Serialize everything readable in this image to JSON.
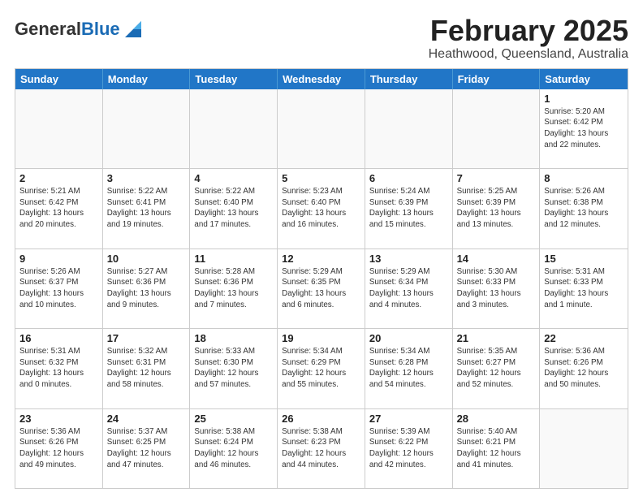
{
  "header": {
    "logo_general": "General",
    "logo_blue": "Blue",
    "title": "February 2025",
    "subtitle": "Heathwood, Queensland, Australia"
  },
  "weekdays": [
    "Sunday",
    "Monday",
    "Tuesday",
    "Wednesday",
    "Thursday",
    "Friday",
    "Saturday"
  ],
  "weeks": [
    [
      {
        "day": "",
        "info": ""
      },
      {
        "day": "",
        "info": ""
      },
      {
        "day": "",
        "info": ""
      },
      {
        "day": "",
        "info": ""
      },
      {
        "day": "",
        "info": ""
      },
      {
        "day": "",
        "info": ""
      },
      {
        "day": "1",
        "info": "Sunrise: 5:20 AM\nSunset: 6:42 PM\nDaylight: 13 hours\nand 22 minutes."
      }
    ],
    [
      {
        "day": "2",
        "info": "Sunrise: 5:21 AM\nSunset: 6:42 PM\nDaylight: 13 hours\nand 20 minutes."
      },
      {
        "day": "3",
        "info": "Sunrise: 5:22 AM\nSunset: 6:41 PM\nDaylight: 13 hours\nand 19 minutes."
      },
      {
        "day": "4",
        "info": "Sunrise: 5:22 AM\nSunset: 6:40 PM\nDaylight: 13 hours\nand 17 minutes."
      },
      {
        "day": "5",
        "info": "Sunrise: 5:23 AM\nSunset: 6:40 PM\nDaylight: 13 hours\nand 16 minutes."
      },
      {
        "day": "6",
        "info": "Sunrise: 5:24 AM\nSunset: 6:39 PM\nDaylight: 13 hours\nand 15 minutes."
      },
      {
        "day": "7",
        "info": "Sunrise: 5:25 AM\nSunset: 6:39 PM\nDaylight: 13 hours\nand 13 minutes."
      },
      {
        "day": "8",
        "info": "Sunrise: 5:26 AM\nSunset: 6:38 PM\nDaylight: 13 hours\nand 12 minutes."
      }
    ],
    [
      {
        "day": "9",
        "info": "Sunrise: 5:26 AM\nSunset: 6:37 PM\nDaylight: 13 hours\nand 10 minutes."
      },
      {
        "day": "10",
        "info": "Sunrise: 5:27 AM\nSunset: 6:36 PM\nDaylight: 13 hours\nand 9 minutes."
      },
      {
        "day": "11",
        "info": "Sunrise: 5:28 AM\nSunset: 6:36 PM\nDaylight: 13 hours\nand 7 minutes."
      },
      {
        "day": "12",
        "info": "Sunrise: 5:29 AM\nSunset: 6:35 PM\nDaylight: 13 hours\nand 6 minutes."
      },
      {
        "day": "13",
        "info": "Sunrise: 5:29 AM\nSunset: 6:34 PM\nDaylight: 13 hours\nand 4 minutes."
      },
      {
        "day": "14",
        "info": "Sunrise: 5:30 AM\nSunset: 6:33 PM\nDaylight: 13 hours\nand 3 minutes."
      },
      {
        "day": "15",
        "info": "Sunrise: 5:31 AM\nSunset: 6:33 PM\nDaylight: 13 hours\nand 1 minute."
      }
    ],
    [
      {
        "day": "16",
        "info": "Sunrise: 5:31 AM\nSunset: 6:32 PM\nDaylight: 13 hours\nand 0 minutes."
      },
      {
        "day": "17",
        "info": "Sunrise: 5:32 AM\nSunset: 6:31 PM\nDaylight: 12 hours\nand 58 minutes."
      },
      {
        "day": "18",
        "info": "Sunrise: 5:33 AM\nSunset: 6:30 PM\nDaylight: 12 hours\nand 57 minutes."
      },
      {
        "day": "19",
        "info": "Sunrise: 5:34 AM\nSunset: 6:29 PM\nDaylight: 12 hours\nand 55 minutes."
      },
      {
        "day": "20",
        "info": "Sunrise: 5:34 AM\nSunset: 6:28 PM\nDaylight: 12 hours\nand 54 minutes."
      },
      {
        "day": "21",
        "info": "Sunrise: 5:35 AM\nSunset: 6:27 PM\nDaylight: 12 hours\nand 52 minutes."
      },
      {
        "day": "22",
        "info": "Sunrise: 5:36 AM\nSunset: 6:26 PM\nDaylight: 12 hours\nand 50 minutes."
      }
    ],
    [
      {
        "day": "23",
        "info": "Sunrise: 5:36 AM\nSunset: 6:26 PM\nDaylight: 12 hours\nand 49 minutes."
      },
      {
        "day": "24",
        "info": "Sunrise: 5:37 AM\nSunset: 6:25 PM\nDaylight: 12 hours\nand 47 minutes."
      },
      {
        "day": "25",
        "info": "Sunrise: 5:38 AM\nSunset: 6:24 PM\nDaylight: 12 hours\nand 46 minutes."
      },
      {
        "day": "26",
        "info": "Sunrise: 5:38 AM\nSunset: 6:23 PM\nDaylight: 12 hours\nand 44 minutes."
      },
      {
        "day": "27",
        "info": "Sunrise: 5:39 AM\nSunset: 6:22 PM\nDaylight: 12 hours\nand 42 minutes."
      },
      {
        "day": "28",
        "info": "Sunrise: 5:40 AM\nSunset: 6:21 PM\nDaylight: 12 hours\nand 41 minutes."
      },
      {
        "day": "",
        "info": ""
      }
    ]
  ]
}
